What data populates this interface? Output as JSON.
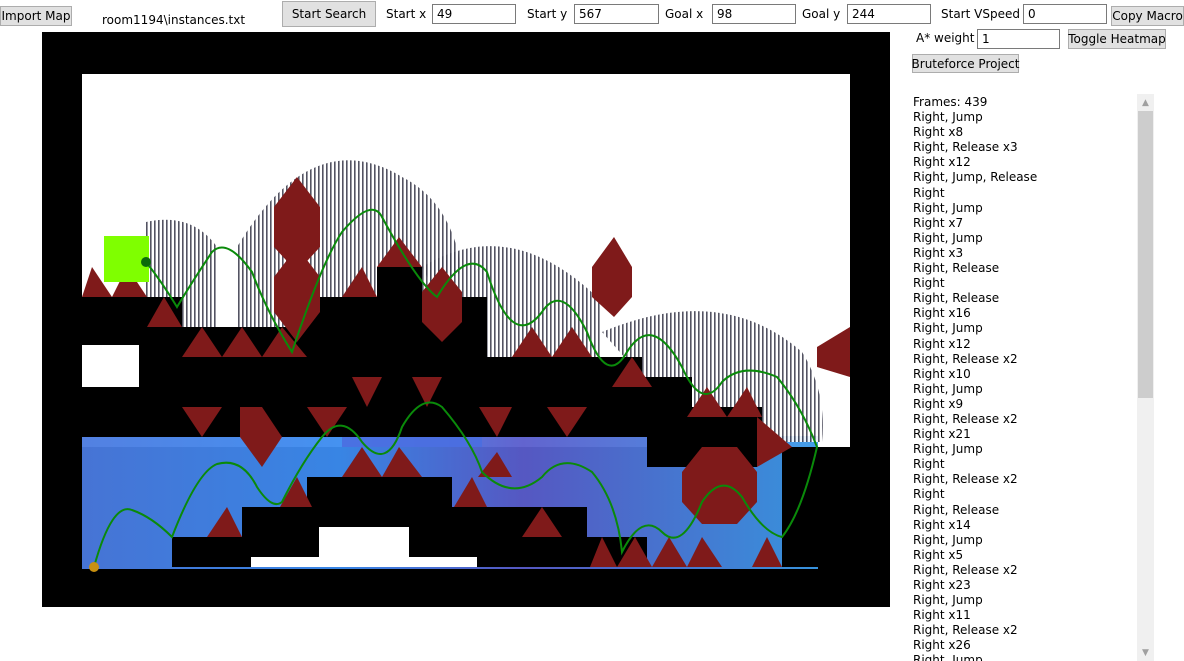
{
  "toolbar": {
    "import_map": "Import Map",
    "map_file": "room1194\\instances.txt",
    "start_search": "Start Search",
    "start_x_label": "Start x",
    "start_x_value": "49",
    "start_y_label": "Start y",
    "start_y_value": "567",
    "goal_x_label": "Goal x",
    "goal_x_value": "98",
    "goal_y_label": "Goal y",
    "goal_y_value": "244",
    "start_vspeed_label": "Start VSpeed",
    "start_vspeed_value": "0",
    "copy_macro": "Copy Macro",
    "astar_weight_label": "A* weight",
    "astar_weight_value": "1",
    "toggle_heatmap": "Toggle Heatmap",
    "bruteforce_project": "Bruteforce Project"
  },
  "macro": {
    "lines": [
      "Frames: 439",
      "Right, Jump",
      "Right x8",
      "Right, Release x3",
      "Right x12",
      "Right, Jump, Release",
      "Right",
      "Right, Jump",
      "Right x7",
      "Right, Jump",
      "Right x3",
      "Right, Release",
      "Right",
      "Right, Release",
      "Right x16",
      "Right, Jump",
      "Right x12",
      "Right, Release x2",
      "Right x10",
      "Right, Jump",
      "Right x9",
      "Right, Release x2",
      "Right x21",
      "Right, Jump",
      "Right",
      "Right, Release x2",
      "Right",
      "Right, Release",
      "Right x14",
      "Right, Jump",
      "Right x5",
      "Right, Release x2",
      "Right x23",
      "Right, Jump",
      "Right x11",
      "Right, Release x2",
      "Right x26",
      "Right, Jump"
    ]
  },
  "colors": {
    "wall": "#000000",
    "spike": "#7f1a1a",
    "goal": "#7fff00",
    "path": "#008a00",
    "start_marker": "#c89010",
    "heat_low": "#3c7cff",
    "heat_high": "#5c2fa8"
  }
}
